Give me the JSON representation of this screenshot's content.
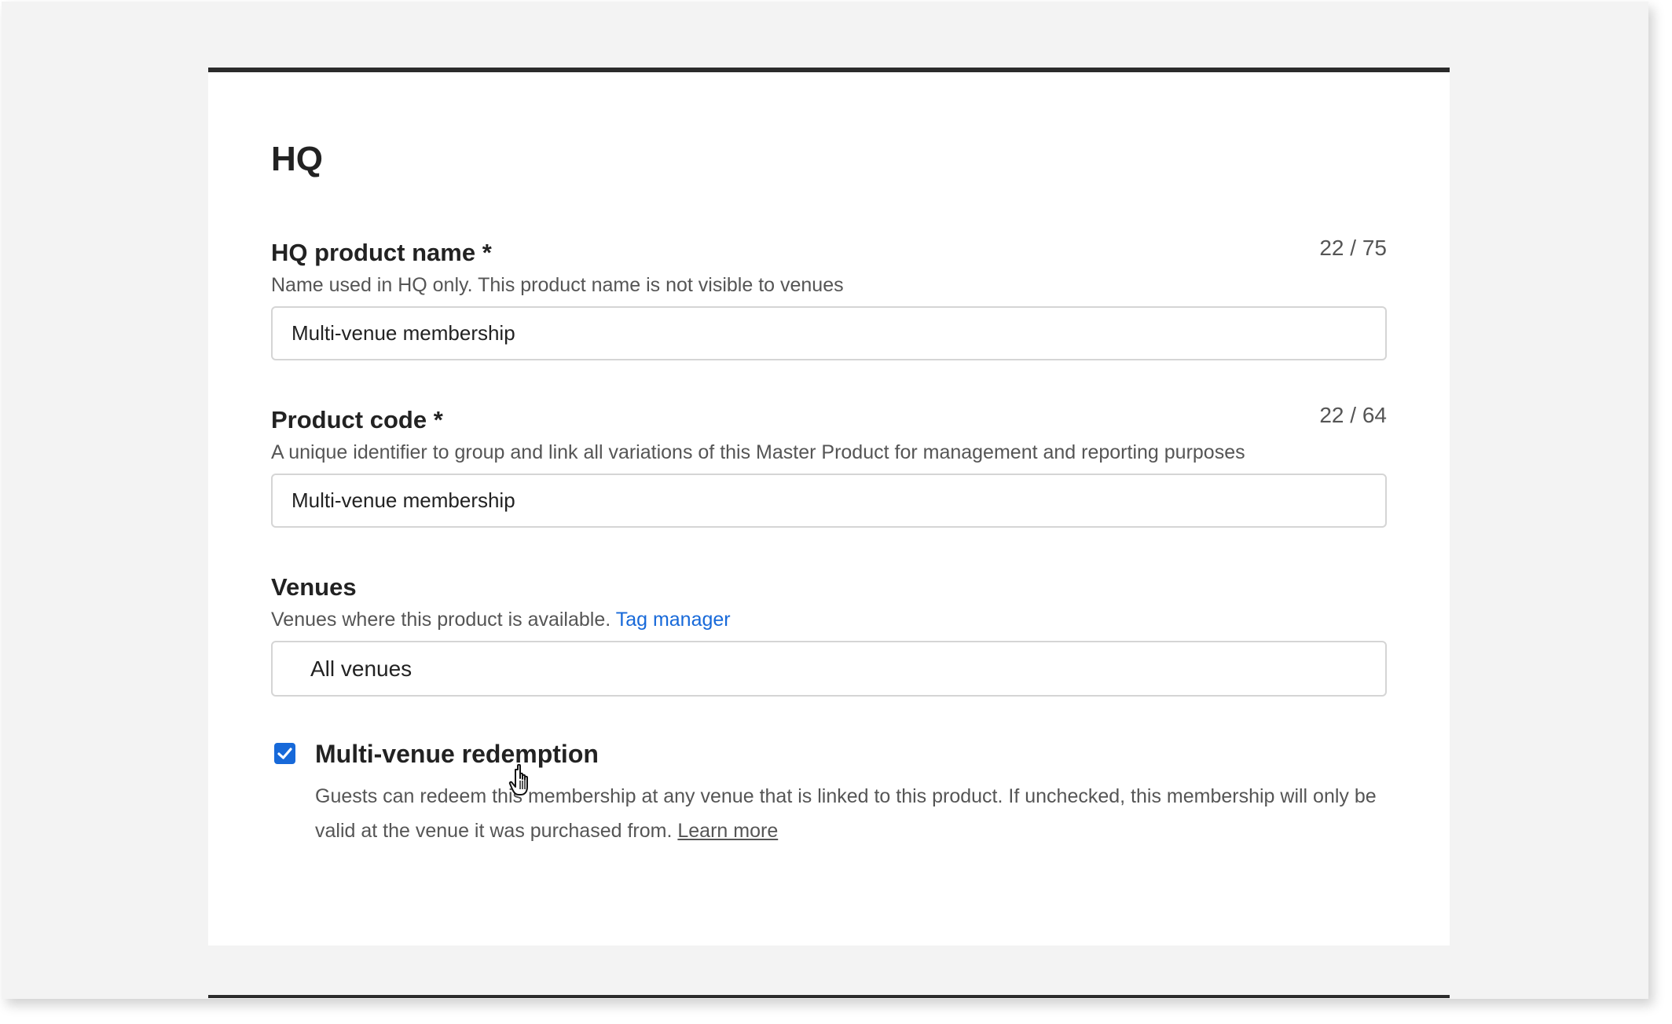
{
  "section": {
    "title": "HQ"
  },
  "hq_product_name": {
    "label": "HQ product name *",
    "counter": "22 / 75",
    "help": "Name used in HQ only. This product name is not visible to venues",
    "value": "Multi-venue membership"
  },
  "product_code": {
    "label": "Product code *",
    "counter": "22 / 64",
    "help": "A unique identifier to group and link all variations of this Master Product for management and reporting purposes",
    "value": "Multi-venue membership"
  },
  "venues": {
    "label": "Venues",
    "help": "Venues where this product is available.",
    "link": "Tag manager",
    "selected": "All venues"
  },
  "multi_venue_redemption": {
    "checked": true,
    "label": "Multi-venue redemption",
    "help": "Guests can redeem this membership at any venue that is linked to this product. If unchecked, this membership will only be valid at the venue it was purchased from.",
    "link": "Learn more"
  },
  "colors": {
    "accent": "#1769d9",
    "heading": "#222222",
    "muted": "#555555"
  }
}
